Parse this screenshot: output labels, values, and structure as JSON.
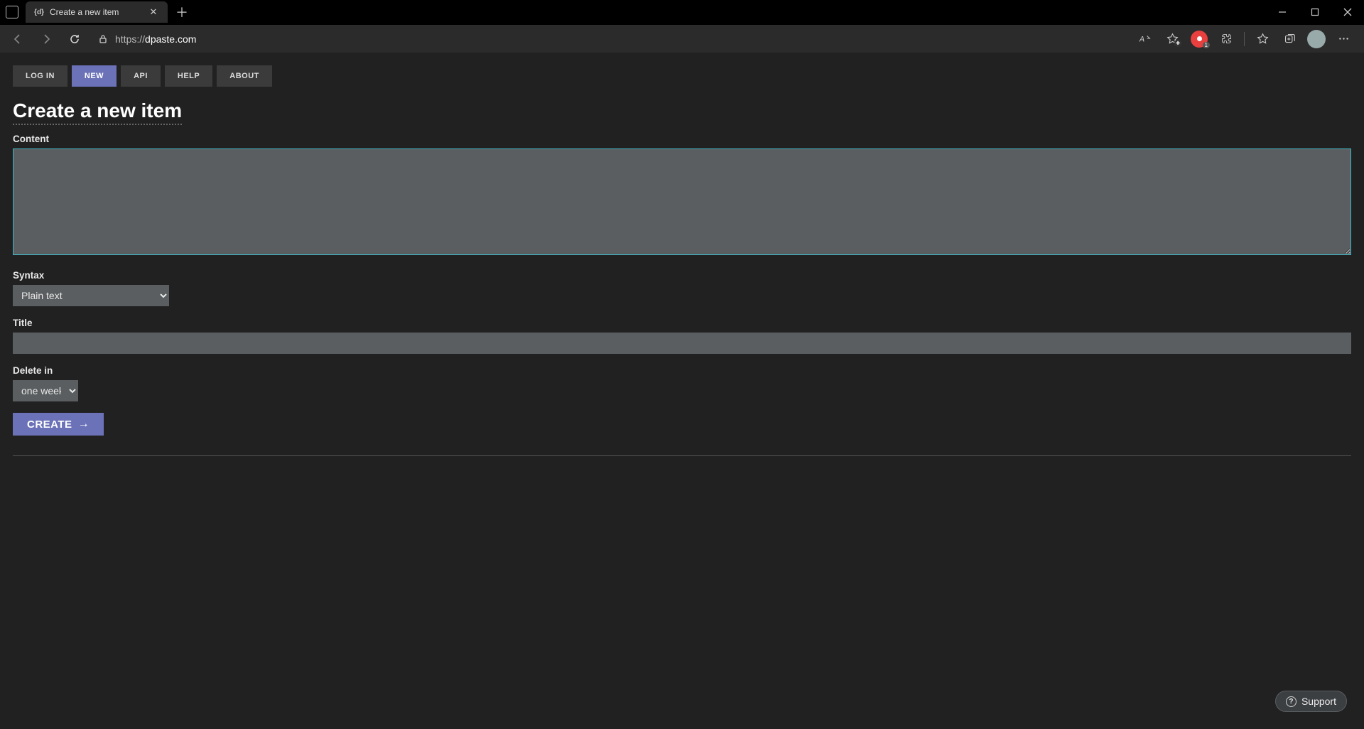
{
  "browser": {
    "tab_title": "Create a new item",
    "tab_favicon_text": "{d}",
    "url_prefix": "https://",
    "url_host": "dpaste.com",
    "ext_badge": "1"
  },
  "nav": {
    "login": "LOG IN",
    "new": "NEW",
    "api": "API",
    "help": "HELP",
    "about": "ABOUT"
  },
  "page": {
    "heading": "Create a new item",
    "labels": {
      "content": "Content",
      "syntax": "Syntax",
      "title": "Title",
      "delete_in": "Delete in"
    },
    "values": {
      "content": "",
      "syntax_selected": "Plain text",
      "title": "",
      "delete_selected": "one week"
    },
    "create_button": "CREATE"
  },
  "support": {
    "label": "Support"
  }
}
